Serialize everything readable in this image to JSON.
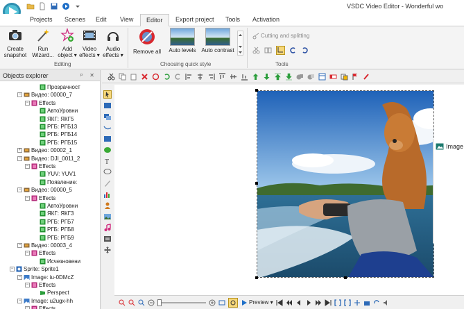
{
  "app": {
    "window_title": "VSDC Video Editor - Wonderful wo",
    "quick_access": [
      "folder-icon",
      "new-file-icon",
      "save-icon",
      "play-icon",
      "dropdown-icon"
    ]
  },
  "tabs": [
    {
      "label": "Projects"
    },
    {
      "label": "Scenes"
    },
    {
      "label": "Edit"
    },
    {
      "label": "View"
    },
    {
      "label": "Editor",
      "active": true
    },
    {
      "label": "Export project"
    },
    {
      "label": "Tools"
    },
    {
      "label": "Activation"
    }
  ],
  "ribbon": {
    "create_snapshot": "Create snapshot",
    "run_wizard": "Run Wizard...",
    "add_object": "Add object ▾",
    "video_effects": "Video effects ▾",
    "audio_effects": "Audio effects ▾",
    "editing_label": "Editing",
    "remove_all": "Remove all",
    "auto_levels": "Auto levels",
    "auto_contrast": "Auto contrast",
    "quick_style_label": "Choosing quick style",
    "cutting_splitting": "Cutting and splitting",
    "tools_label": "Tools"
  },
  "explorer": {
    "title": "Objects explorer",
    "controls": "ᵖ ✕",
    "items": [
      {
        "label": "Прозрачност",
        "level": 4,
        "icon": "effect-icon",
        "expander": ""
      },
      {
        "label": "Видео: 00000_7",
        "level": 2,
        "icon": "video-icon",
        "expander": "−"
      },
      {
        "label": "Effects",
        "level": 3,
        "icon": "effects-icon",
        "expander": "−"
      },
      {
        "label": "АвтоУровни",
        "level": 4,
        "icon": "effect-icon",
        "expander": ""
      },
      {
        "label": "ЯКГ: ЯКГ5",
        "level": 4,
        "icon": "effect-icon",
        "expander": ""
      },
      {
        "label": "РГБ: РГБ13",
        "level": 4,
        "icon": "effect-icon",
        "expander": ""
      },
      {
        "label": "РГБ: РГБ14",
        "level": 4,
        "icon": "effect-icon",
        "expander": ""
      },
      {
        "label": "РГБ: РГБ15",
        "level": 4,
        "icon": "effect-icon",
        "expander": ""
      },
      {
        "label": "Видео: 00002_1",
        "level": 2,
        "icon": "video-icon",
        "expander": "+"
      },
      {
        "label": "Видео: DJI_0011_2",
        "level": 2,
        "icon": "video-icon",
        "expander": "−"
      },
      {
        "label": "Effects",
        "level": 3,
        "icon": "effects-icon",
        "expander": "−"
      },
      {
        "label": "YUV: YUV1",
        "level": 4,
        "icon": "effect-icon",
        "expander": ""
      },
      {
        "label": "Появление:",
        "level": 4,
        "icon": "effect-icon",
        "expander": ""
      },
      {
        "label": "Видео: 00000_5",
        "level": 2,
        "icon": "video-icon",
        "expander": "−"
      },
      {
        "label": "Effects",
        "level": 3,
        "icon": "effects-icon",
        "expander": "−"
      },
      {
        "label": "АвтоУровни",
        "level": 4,
        "icon": "effect-icon",
        "expander": ""
      },
      {
        "label": "ЯКГ: ЯКГ3",
        "level": 4,
        "icon": "effect-icon",
        "expander": ""
      },
      {
        "label": "РГБ: РГБ7",
        "level": 4,
        "icon": "effect-icon",
        "expander": ""
      },
      {
        "label": "РГБ: РГБ8",
        "level": 4,
        "icon": "effect-icon",
        "expander": ""
      },
      {
        "label": "РГБ: РГБ9",
        "level": 4,
        "icon": "effect-icon",
        "expander": ""
      },
      {
        "label": "Видео: 00003_4",
        "level": 2,
        "icon": "video-icon",
        "expander": "−"
      },
      {
        "label": "Effects",
        "level": 3,
        "icon": "effects-icon",
        "expander": "−"
      },
      {
        "label": "Исчезновени",
        "level": 4,
        "icon": "effect-icon",
        "expander": ""
      },
      {
        "label": "Sprite: Sprite1",
        "level": 1,
        "icon": "sprite-icon",
        "expander": "−"
      },
      {
        "label": "Image: iu-0DMcZ",
        "level": 2,
        "icon": "image-icon",
        "expander": "−"
      },
      {
        "label": "Effects",
        "level": 3,
        "icon": "effects-icon",
        "expander": "−"
      },
      {
        "label": "Perspect",
        "level": 4,
        "icon": "perspective-icon",
        "expander": ""
      },
      {
        "label": "Image: u2ugx-hh",
        "level": 2,
        "icon": "image-icon",
        "expander": "−"
      },
      {
        "label": "Effects",
        "level": 3,
        "icon": "effects-icon",
        "expander": "−"
      }
    ]
  },
  "canvas": {
    "clip_label": "Image"
  },
  "preview": {
    "label": "Preview ▾"
  },
  "colors": {
    "accent_tab_border": "#c9c9c9",
    "play_blue": "#1e6fc8",
    "remove_red": "#d8282f"
  }
}
